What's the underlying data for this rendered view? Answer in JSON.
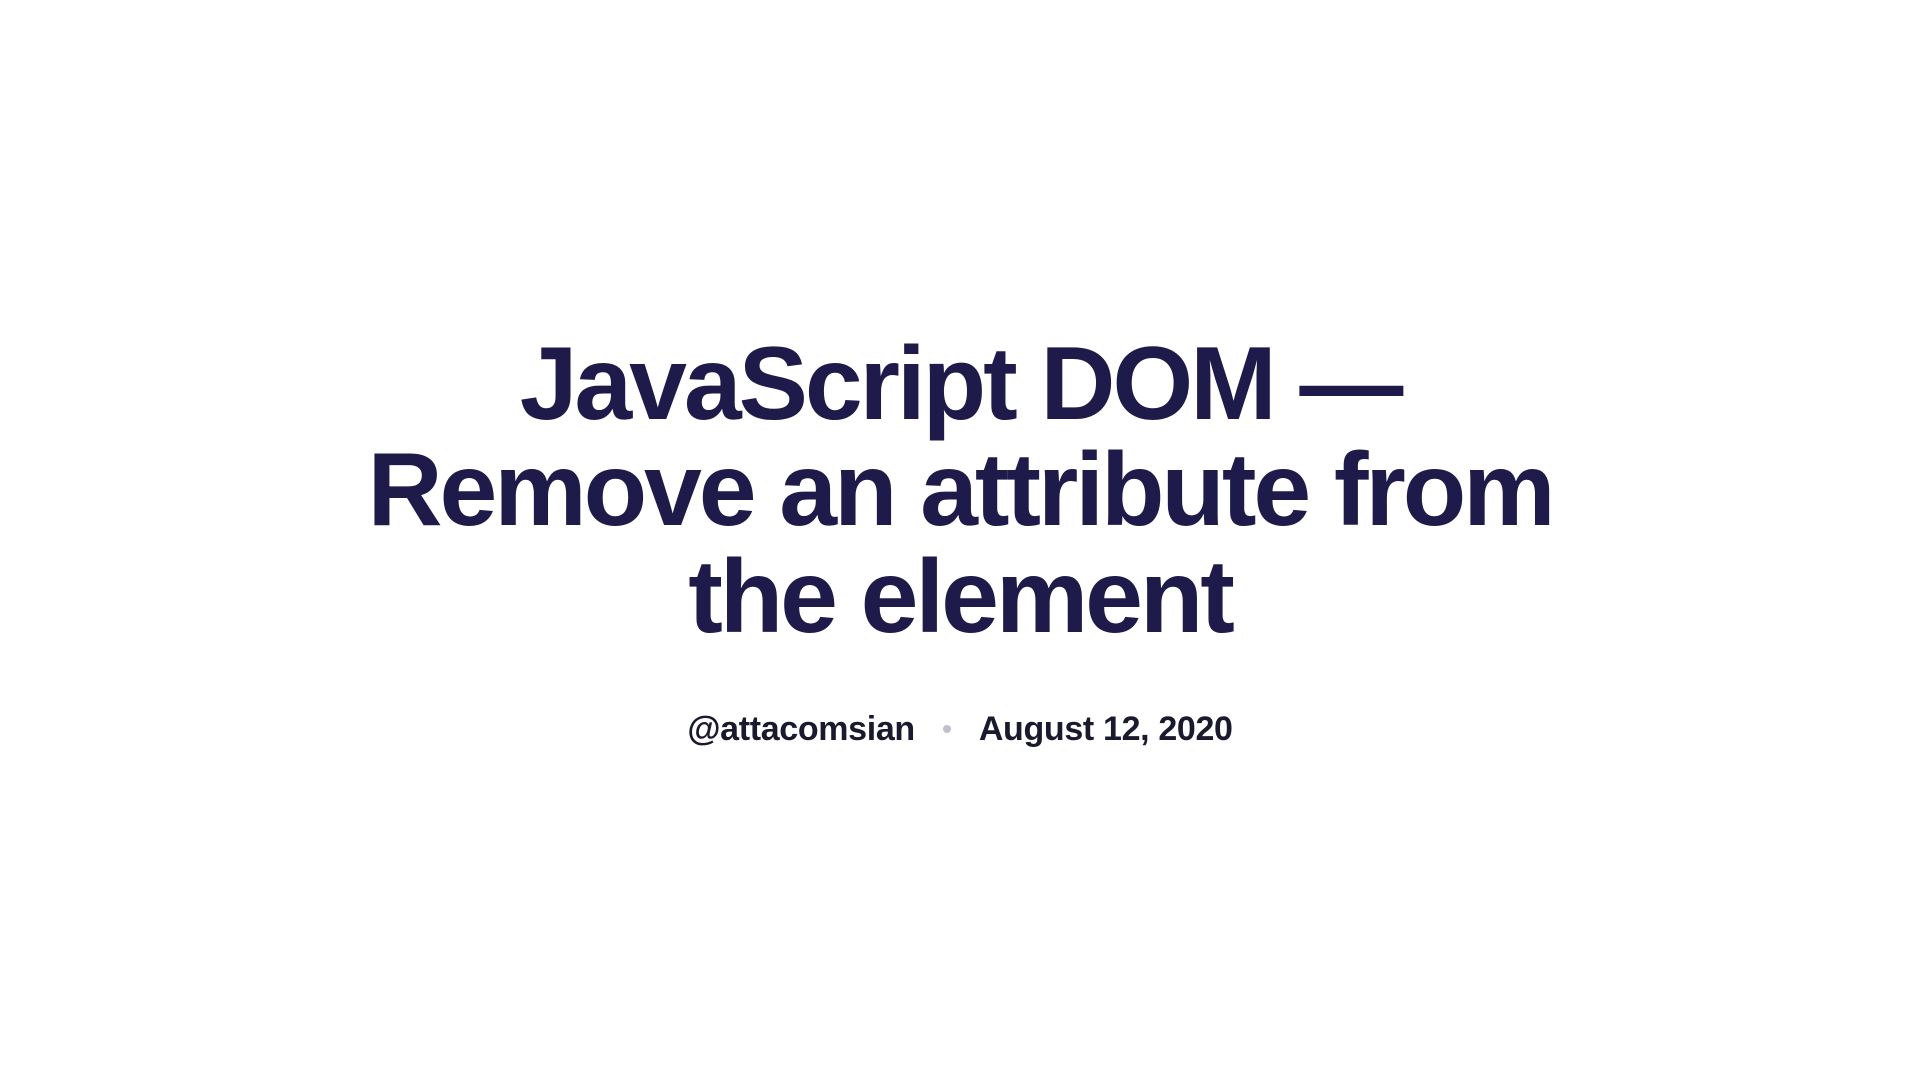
{
  "article": {
    "title": "JavaScript DOM — Remove an attribute from the element",
    "author": "@attacomsian",
    "date": "August 12, 2020"
  }
}
